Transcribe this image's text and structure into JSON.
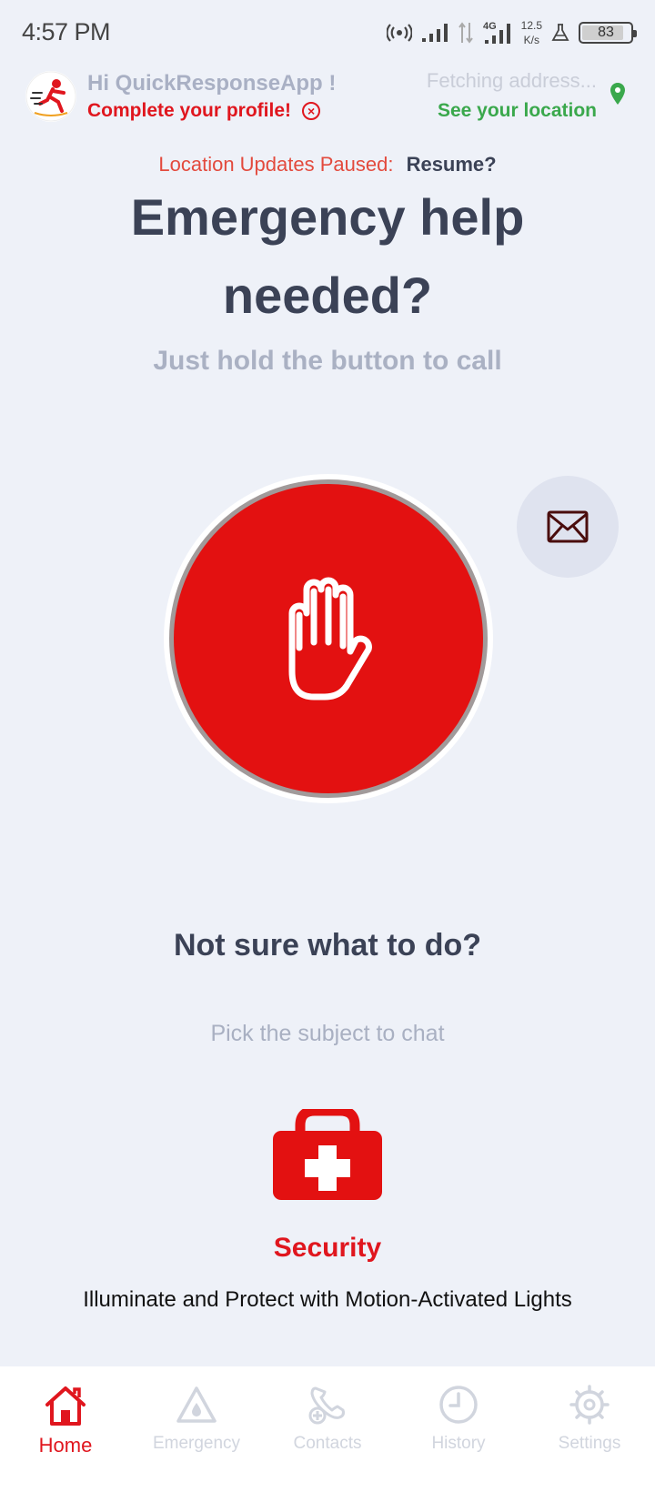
{
  "status_bar": {
    "time": "4:57 PM",
    "network_speed_value": "12.5",
    "network_speed_unit": "K/s",
    "network_type": "4G",
    "battery_level": "83"
  },
  "header": {
    "greeting": "Hi QuickResponseApp !",
    "profile_prompt": "Complete your profile!",
    "address_status": "Fetching address...",
    "location_link": "See your location"
  },
  "location_paused": {
    "label": "Location Updates Paused:",
    "action": "Resume?"
  },
  "main": {
    "headline": "Emergency help needed?",
    "subheadline": "Just hold the button to call",
    "sos_icon": "raised-hand-icon",
    "message_icon": "envelope-icon",
    "help_title": "Not sure what to do?",
    "help_subtitle": "Pick the subject to chat"
  },
  "subject": {
    "icon": "first-aid-kit-icon",
    "title": "Security",
    "description": "Illuminate and Protect with Motion-Activated Lights"
  },
  "bottom_nav": {
    "items": [
      {
        "label": "Home",
        "icon": "home-icon",
        "active": true
      },
      {
        "label": "Emergency",
        "icon": "warning-drop-icon",
        "active": false
      },
      {
        "label": "Contacts",
        "icon": "contacts-icon",
        "active": false
      },
      {
        "label": "History",
        "icon": "clock-icon",
        "active": false
      },
      {
        "label": "Settings",
        "icon": "gear-icon",
        "active": false
      }
    ]
  },
  "colors": {
    "accent_red": "#e31111",
    "background": "#eef1f8",
    "location_green": "#3aa84c",
    "text_dark": "#3b4256",
    "text_muted": "#aab1c3"
  }
}
